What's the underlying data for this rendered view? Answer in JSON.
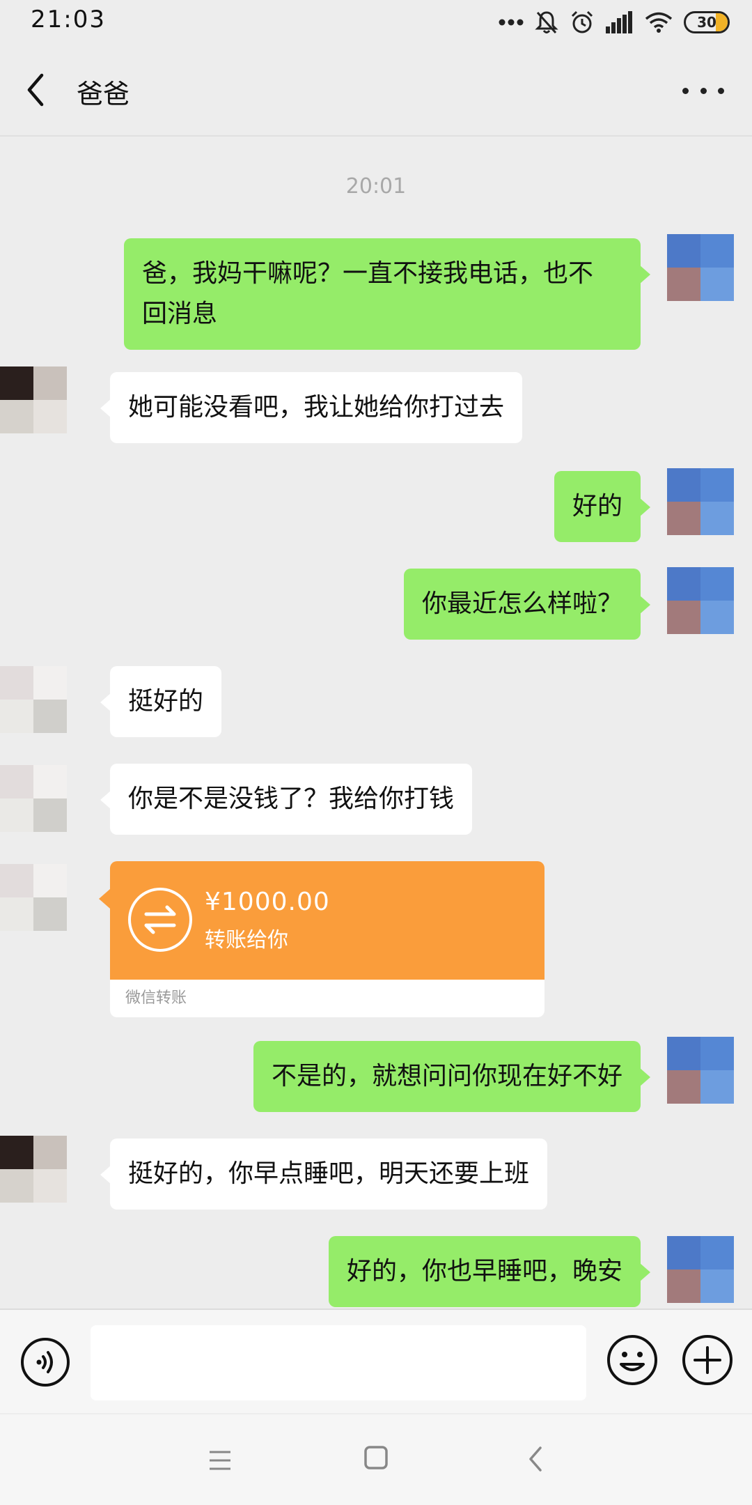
{
  "status_bar": {
    "time": "21:03",
    "battery_level": "30",
    "icons": [
      "more-dots-icon",
      "mute-bell-icon",
      "alarm-icon",
      "signal-icon",
      "wifi-icon",
      "battery-icon"
    ]
  },
  "header": {
    "title": "爸爸",
    "back_icon": "chevron-left-icon",
    "more_icon": "more-horizontal-icon"
  },
  "timestamp": "20:01",
  "messages": [
    {
      "sender": "me",
      "text_lines": [
        "爸，我妈干嘛呢？一直不接我电话，也不",
        "回消息"
      ]
    },
    {
      "sender": "dad",
      "text": "她可能没看吧，我让她给你打过去"
    },
    {
      "sender": "me",
      "text": "好的"
    },
    {
      "sender": "me",
      "text": "你最近怎么样啦？"
    },
    {
      "sender": "dad",
      "text": "挺好的"
    },
    {
      "sender": "dad",
      "text": "你是不是没钱了？我给你打钱"
    },
    {
      "sender": "dad",
      "type": "transfer",
      "amount": "¥1000.00",
      "description": "转账给你",
      "footer": "微信转账"
    },
    {
      "sender": "me",
      "text": "不是的，就想问问你现在好不好"
    },
    {
      "sender": "dad",
      "text": "挺好的，你早点睡吧，明天还要上班"
    },
    {
      "sender": "me",
      "text": "好的，你也早睡吧，晚安"
    }
  ],
  "input_bar": {
    "voice_icon": "voice-icon",
    "input_value": "",
    "emoji_icon": "emoji-icon",
    "plus_icon": "plus-circle-icon"
  },
  "nav_bar": {
    "icons": [
      "menu-icon",
      "home-square-icon",
      "back-arrow-icon"
    ]
  },
  "colors": {
    "background": "#ededed",
    "my_bubble": "#95ec69",
    "other_bubble": "#ffffff",
    "transfer": "#fa9d3b"
  }
}
